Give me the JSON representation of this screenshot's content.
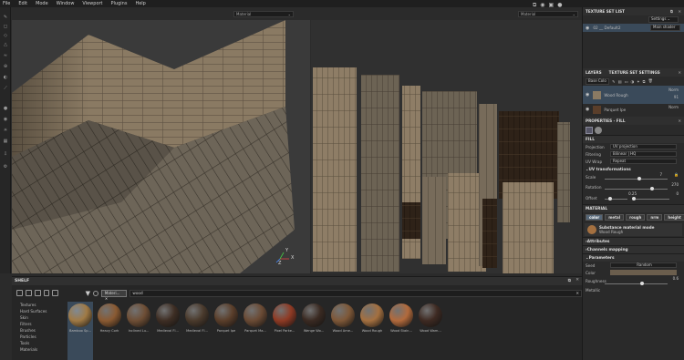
{
  "menu": [
    "File",
    "Edit",
    "Mode",
    "Window",
    "Viewport",
    "Plugins",
    "Help"
  ],
  "viewport": {
    "left_mode": "Material",
    "right_mode": "Material",
    "axis_x": "X",
    "axis_y": "Y",
    "axis_z": "Z"
  },
  "shelf": {
    "title": "SHELF",
    "filter_chip": "Materi...",
    "search_value": "wood",
    "categories": [
      "Textures",
      "Hard Surfaces",
      "Skin",
      "Filters",
      "Brushes",
      "Particles",
      "Tools",
      "Materials"
    ],
    "materials": [
      {
        "name": "Bamboo Sp...",
        "color": "#a07a45"
      },
      {
        "name": "Heavy Cork",
        "color": "#8a5a32"
      },
      {
        "name": "Inclined Lu...",
        "color": "#6e4e35"
      },
      {
        "name": "Medieval Fl...",
        "color": "#3e2e24"
      },
      {
        "name": "Medieval Fl...",
        "color": "#4a3a2c"
      },
      {
        "name": "Parquet Ipe",
        "color": "#5a3e2a"
      },
      {
        "name": "Parquet Ma...",
        "color": "#6a4a34"
      },
      {
        "name": "Pixel Parke...",
        "color": "#8e3a24"
      },
      {
        "name": "Wenge Wo...",
        "color": "#3a2a22"
      },
      {
        "name": "Wood Ame...",
        "color": "#7e5838"
      },
      {
        "name": "Wood Rough",
        "color": "#a47040"
      },
      {
        "name": "Wood Stain...",
        "color": "#b26a3c"
      },
      {
        "name": "Wood Wam...",
        "color": "#3e2a22"
      }
    ]
  },
  "texture_set_list": {
    "title": "TEXTURE SET LIST",
    "settings_label": "Settings",
    "item_name": "02 __ Default2",
    "shader": "Main shader"
  },
  "layers": {
    "tab1": "LAYERS",
    "tab2": "TEXTURE SET SETTINGS",
    "channel": "Base Colo",
    "items": [
      {
        "name": "Wood Rough",
        "blend": "Norm",
        "opacity": "91"
      },
      {
        "name": "Parquet Ipe",
        "blend": "Norm",
        "opacity": ""
      }
    ]
  },
  "properties": {
    "title": "PROPERTIES - FILL",
    "fill_header": "FILL",
    "projection_label": "Projection",
    "projection_value": "UV projection",
    "filtering_label": "Filtering",
    "filtering_value": "Bilinear | HQ",
    "uvwrap_label": "UV Wrap",
    "uvwrap_value": "Repeat",
    "uvtrans_header": "UV transformations",
    "scale_label": "Scale",
    "scale_value": "7",
    "rotation_label": "Rotation",
    "rotation_value": "270",
    "offset_label": "Offset",
    "offset_u": "0.25",
    "offset_v": "0",
    "material_header": "MATERIAL",
    "chips": [
      "color",
      "metal",
      "rough",
      "nrm",
      "height"
    ],
    "substance_title": "Substance material mode",
    "substance_name": "Wood Rough",
    "attributes": "Attributes",
    "channels": "Channels mapping",
    "parameters": "Parameters",
    "seed_label": "Seed",
    "seed_value": "Random",
    "color_label": "Color",
    "roughness_label": "Roughness",
    "roughness_value": "0.6",
    "metallic_label": "Metallic"
  },
  "progress": {
    "scale_fraction": 0.55,
    "rotation_fraction": 0.75,
    "offset_u_fraction": 0.25,
    "offset_v_fraction": 0.0,
    "roughness_fraction": 0.6
  }
}
